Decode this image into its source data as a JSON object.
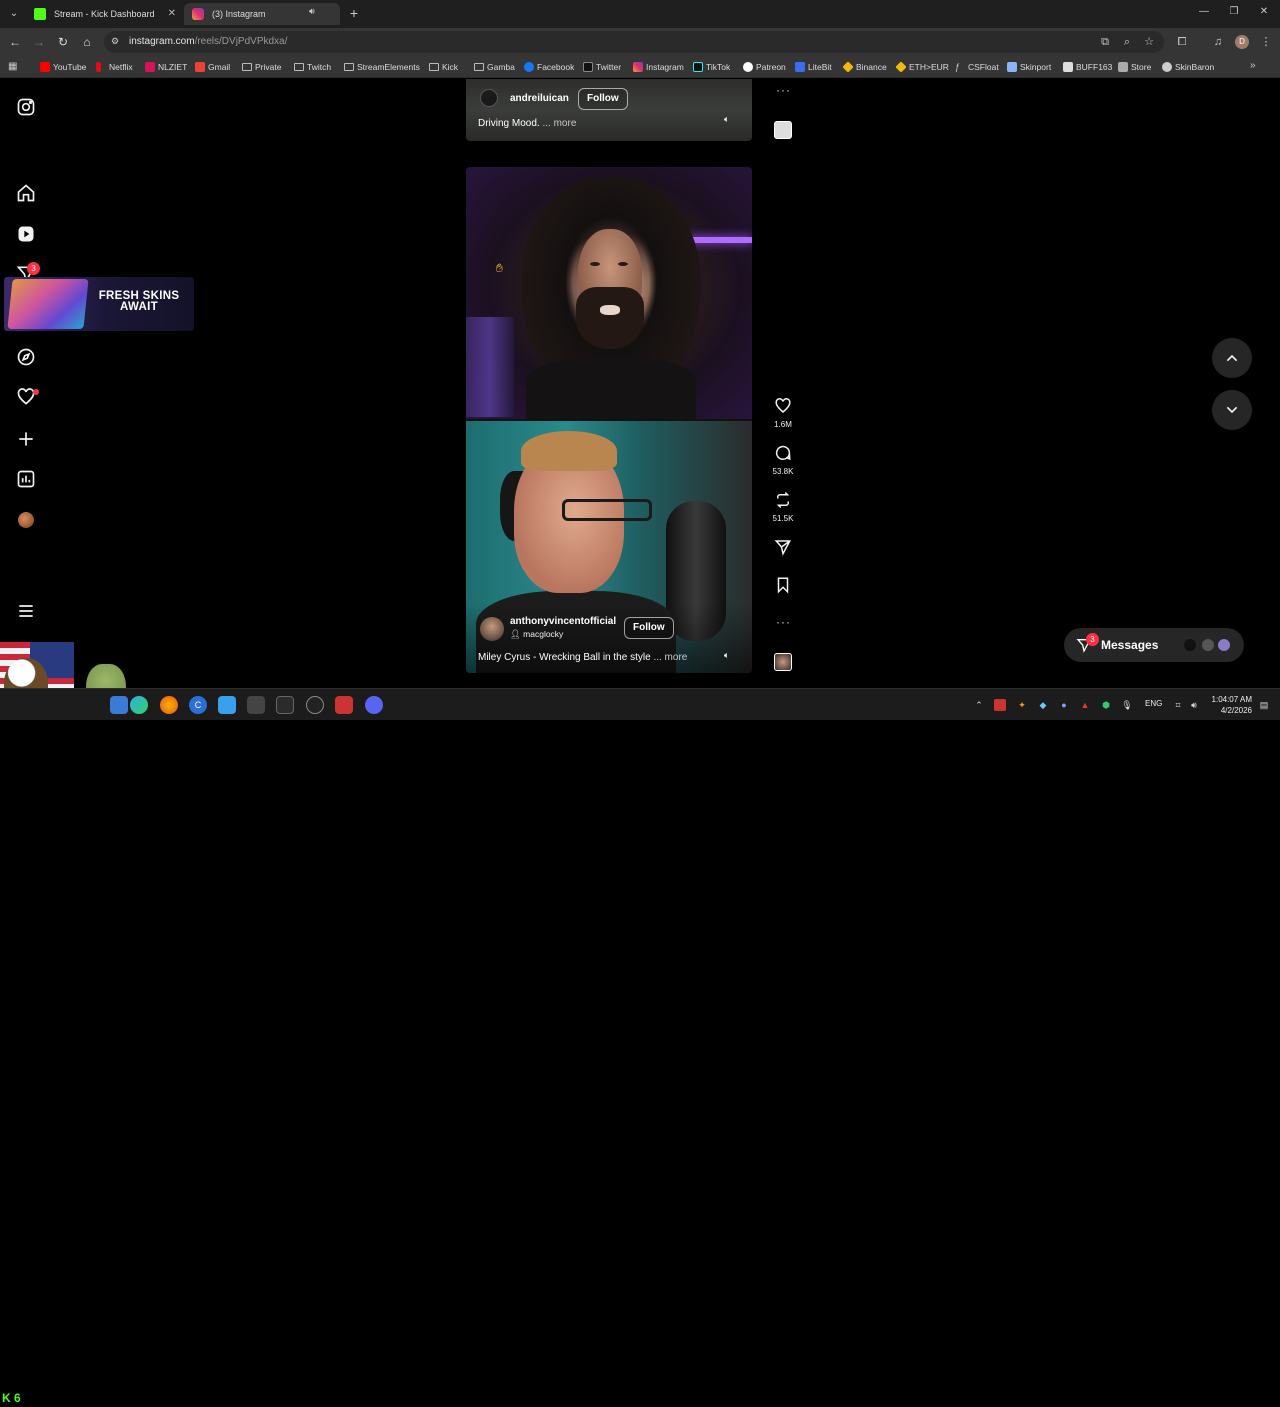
{
  "tabs": [
    {
      "label": "Stream - Kick Dashboard",
      "icon": "kick-icon"
    },
    {
      "label": "(3) Instagram",
      "icon": "instagram-icon"
    }
  ],
  "address": {
    "host": "instagram.com",
    "path": "/reels/DVjPdVPkdxa/"
  },
  "profile_initial": "D",
  "bookmarks": [
    "YouTube",
    "Netflix",
    "NLZIET",
    "Gmail",
    "Private",
    "Twitch",
    "StreamElements",
    "Kick",
    "Gamba",
    "Facebook",
    "Twitter",
    "Instagram",
    "TikTok",
    "Patreon",
    "LiteBit",
    "Binance",
    "ETH>EUR",
    "CSFloat",
    "Skinport",
    "BUFF163",
    "Store",
    "SkinBaron"
  ],
  "sidebar": {
    "reels_badge": "3"
  },
  "ad": {
    "text": "FRESH SKINS AWAIT"
  },
  "reel_top": {
    "username": "andreiluican",
    "follow": "Follow",
    "caption": "Driving Mood.",
    "more": "... more"
  },
  "reel_main": {
    "username": "anthonyvincentofficial",
    "collab": "macglocky",
    "follow": "Follow",
    "caption": "Miley Cyrus - Wrecking Ball in the style",
    "more": "... more"
  },
  "actions": {
    "likes": "1.6M",
    "comments": "53.8K",
    "reposts": "51.5K"
  },
  "messages": {
    "label": "Messages",
    "badge": "3"
  },
  "tray": {
    "lang": "ENG",
    "time": "1:04:07 AM",
    "date": "4/2/2026"
  },
  "overlay": {
    "kick_count": "6"
  },
  "colors": {
    "accent_red": "#ff3040",
    "kick_green": "#53fc18",
    "ig_blue": "#0095f6"
  }
}
